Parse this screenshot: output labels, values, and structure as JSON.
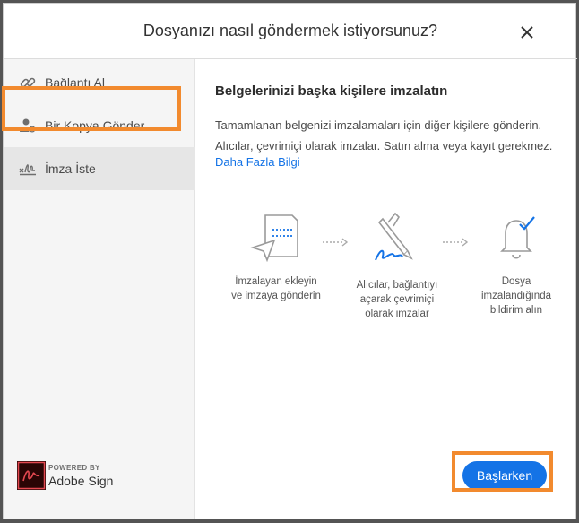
{
  "dialog": {
    "title": "Dosyanızı nasıl göndermek istiyorsunuz?"
  },
  "sidebar": {
    "items": [
      {
        "label": "Bağlantı Al",
        "icon": "link-icon"
      },
      {
        "label": "Bir Kopya Gönder",
        "icon": "add-person-icon"
      },
      {
        "label": "İmza İste",
        "icon": "signature-icon",
        "selected": true
      }
    ]
  },
  "main": {
    "heading": "Belgelerinizi başka kişilere imzalatın",
    "desc_line1": "Tamamlanan belgenizi imzalamaları için diğer kişilere gönderin.",
    "desc_line2": "Alıcılar, çevrimiçi olarak imzalar. Satın alma veya kayıt gerekmez.",
    "learn_more": "Daha Fazla Bilgi",
    "steps": [
      {
        "line1": "İmzalayan ekleyin",
        "line2": "ve imzaya gönderin",
        "line3": ""
      },
      {
        "line1": "Alıcılar, bağlantıyı",
        "line2": "açarak çevrimiçi",
        "line3": "olarak imzalar"
      },
      {
        "line1": "Dosya",
        "line2": "imzalandığında",
        "line3": "bildirim alın"
      }
    ]
  },
  "footer": {
    "powered_by": "POWERED BY",
    "brand": "Adobe Sign",
    "start_button": "Başlarken"
  },
  "colors": {
    "accent": "#1473e6",
    "highlight": "#f28a2e"
  }
}
